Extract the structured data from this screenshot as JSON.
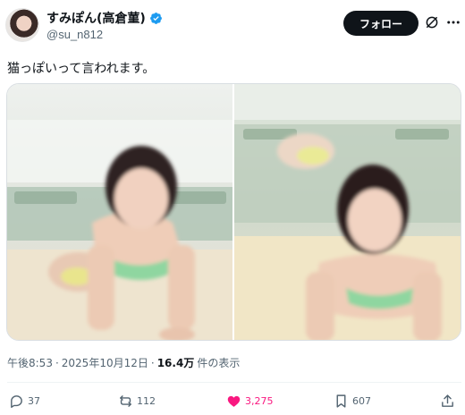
{
  "author": {
    "display_name": "すみぽん(高倉菫)",
    "handle": "@su_n812",
    "verified": true
  },
  "header": {
    "follow_label": "フォロー"
  },
  "tweet": {
    "text": "猫っぽいって言われます。"
  },
  "meta": {
    "time": "午後8:53",
    "separator": "·",
    "date": "2025年10月12日",
    "separator2": "·",
    "views_count": "16.4万",
    "views_label": "件の表示"
  },
  "actions": {
    "replies": "37",
    "reposts": "112",
    "likes": "3,275",
    "bookmarks": "607"
  },
  "colors": {
    "text": "#0f1419",
    "secondary": "#536471",
    "verified": "#1d9bf0",
    "like": "#f91880",
    "button_bg": "#0f1419"
  }
}
